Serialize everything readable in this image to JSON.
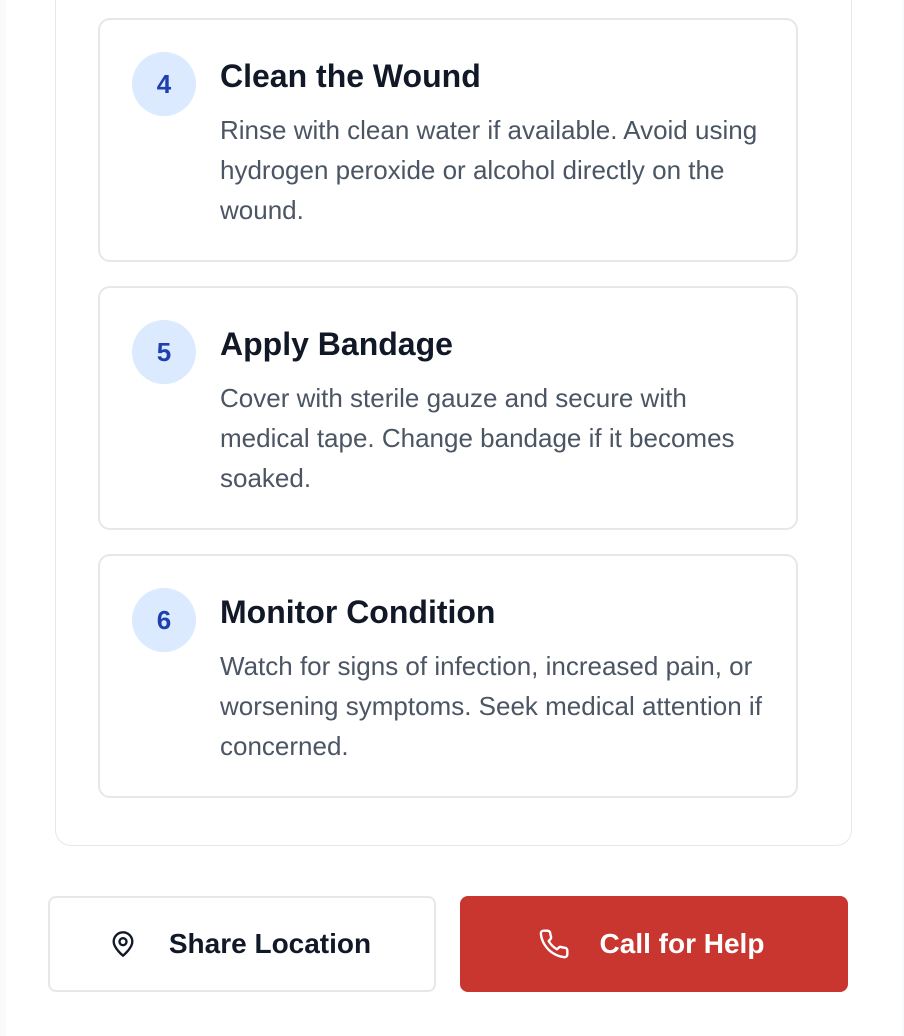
{
  "steps": [
    {
      "number": "4",
      "title": "Clean the Wound",
      "description": "Rinse with clean water if available. Avoid using hydrogen peroxide or alcohol directly on the wound."
    },
    {
      "number": "5",
      "title": "Apply Bandage",
      "description": "Cover with sterile gauze and secure with medical tape. Change bandage if it becomes soaked."
    },
    {
      "number": "6",
      "title": "Monitor Condition",
      "description": "Watch for signs of infection, increased pain, or worsening symptoms. Seek medical attention if concerned."
    }
  ],
  "actions": {
    "share_location": {
      "label": "Share Location",
      "icon": "map-pin-icon"
    },
    "call_for_help": {
      "label": "Call for Help",
      "icon": "phone-icon"
    }
  },
  "colors": {
    "accent": "#c9352f",
    "step_badge_bg": "#dbeafe",
    "step_badge_text": "#1e40af",
    "border": "#e5e7eb"
  }
}
